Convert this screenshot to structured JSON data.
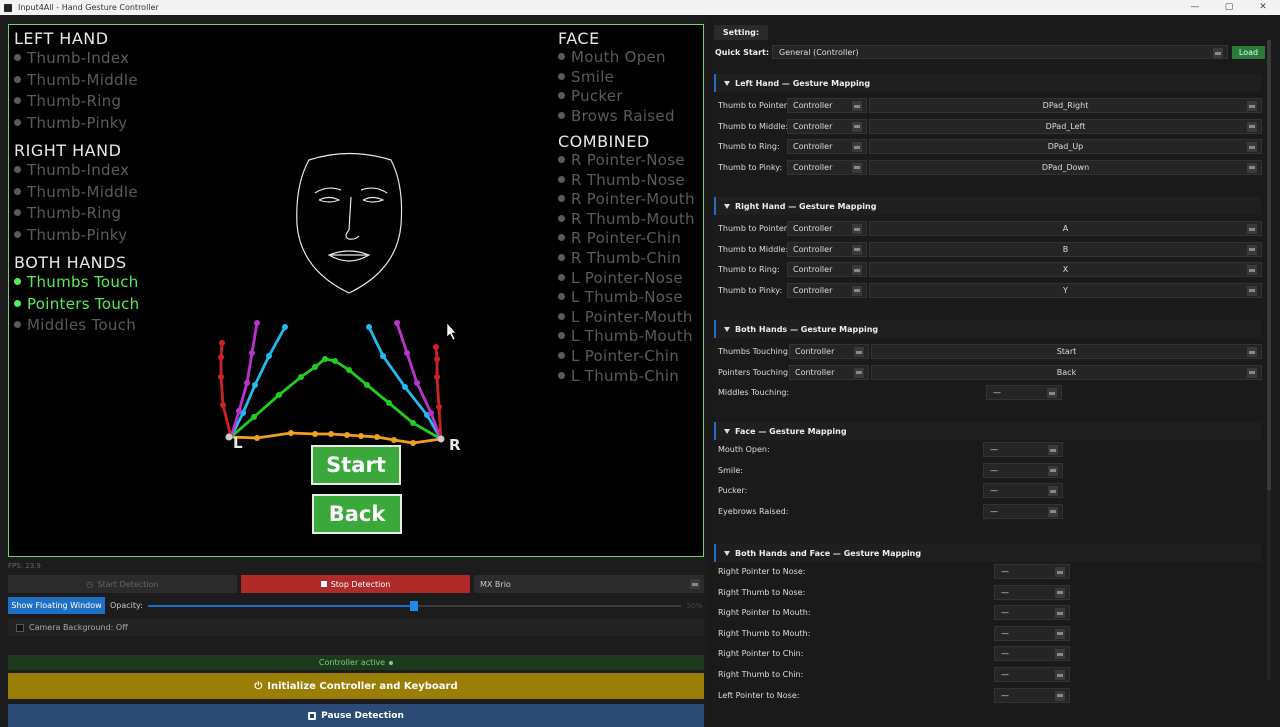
{
  "window": {
    "title": "Input4All - Hand Gesture Controller",
    "controls": [
      "—",
      "▢",
      "✕"
    ]
  },
  "camera": {
    "left_hand": {
      "title": "LEFT HAND",
      "items": [
        {
          "label": "Thumb-Index",
          "active": false
        },
        {
          "label": "Thumb-Middle",
          "active": false
        },
        {
          "label": "Thumb-Ring",
          "active": false
        },
        {
          "label": "Thumb-Pinky",
          "active": false
        }
      ]
    },
    "right_hand": {
      "title": "RIGHT HAND",
      "items": [
        {
          "label": "Thumb-Index",
          "active": false
        },
        {
          "label": "Thumb-Middle",
          "active": false
        },
        {
          "label": "Thumb-Ring",
          "active": false
        },
        {
          "label": "Thumb-Pinky",
          "active": false
        }
      ]
    },
    "both_hands": {
      "title": "BOTH HANDS",
      "items": [
        {
          "label": "Thumbs Touch",
          "active": true
        },
        {
          "label": "Pointers Touch",
          "active": true
        },
        {
          "label": "Middles Touch",
          "active": false
        }
      ]
    },
    "face": {
      "title": "FACE",
      "items": [
        {
          "label": "Mouth Open",
          "active": false
        },
        {
          "label": "Smile",
          "active": false
        },
        {
          "label": "Pucker",
          "active": false
        },
        {
          "label": "Brows Raised",
          "active": false
        }
      ]
    },
    "combined": {
      "title": "COMBINED",
      "items": [
        {
          "label": "R Pointer-Nose",
          "active": false
        },
        {
          "label": "R Thumb-Nose",
          "active": false
        },
        {
          "label": "R Pointer-Mouth",
          "active": false
        },
        {
          "label": "R Thumb-Mouth",
          "active": false
        },
        {
          "label": "R Pointer-Chin",
          "active": false
        },
        {
          "label": "R Thumb-Chin",
          "active": false
        },
        {
          "label": "L Pointer-Nose",
          "active": false
        },
        {
          "label": "L Thumb-Nose",
          "active": false
        },
        {
          "label": "L Pointer-Mouth",
          "active": false
        },
        {
          "label": "L Thumb-Mouth",
          "active": false
        },
        {
          "label": "L Pointer-Chin",
          "active": false
        },
        {
          "label": "L Thumb-Chin",
          "active": false
        }
      ]
    },
    "overlay": {
      "start_label": "Start",
      "back_label": "Back",
      "left_marker": "L",
      "right_marker": "R"
    },
    "colors": {
      "active": "#55ee55",
      "inactive": "#5a5a5a",
      "border": "#6fcf73"
    }
  },
  "fps": "FPS: 23.9",
  "controls": {
    "start_detection": "Start Detection",
    "stop_detection": "Stop Detection",
    "camera_select": "MX Brio",
    "show_floating": "Show Floating Window",
    "opacity_label": "Opacity:",
    "opacity_value": 0.5,
    "opacity_text": "50%",
    "camera_background": "Camera Background: Off",
    "status": "Controller active",
    "initialize": "Initialize Controller and Keyboard",
    "pause": "Pause Detection"
  },
  "settings": {
    "tab": "Setting:",
    "quick_start_label": "Quick Start:",
    "quick_start_value": "General (Controller)",
    "load_label": "Load",
    "left_hand": {
      "title": "Left Hand — Gesture Mapping",
      "rows": [
        {
          "label": "Thumb to Pointer:",
          "device": "Controller",
          "value": "DPad_Right"
        },
        {
          "label": "Thumb to Middle:",
          "device": "Controller",
          "value": "DPad_Left"
        },
        {
          "label": "Thumb to Ring:",
          "device": "Controller",
          "value": "DPad_Up"
        },
        {
          "label": "Thumb to Pinky:",
          "device": "Controller",
          "value": "DPad_Down"
        }
      ]
    },
    "right_hand": {
      "title": "Right Hand — Gesture Mapping",
      "rows": [
        {
          "label": "Thumb to Pointer:",
          "device": "Controller",
          "value": "A"
        },
        {
          "label": "Thumb to Middle:",
          "device": "Controller",
          "value": "B"
        },
        {
          "label": "Thumb to Ring:",
          "device": "Controller",
          "value": "X"
        },
        {
          "label": "Thumb to Pinky:",
          "device": "Controller",
          "value": "Y"
        }
      ]
    },
    "both_hands": {
      "title": "Both Hands — Gesture Mapping",
      "rows": [
        {
          "label": "Thumbs Touching:",
          "device": "Controller",
          "value": "Start"
        },
        {
          "label": "Pointers Touching:",
          "device": "Controller",
          "value": "Back"
        }
      ],
      "middles_label": "Middles Touching:",
      "middles_value": "—"
    },
    "face": {
      "title": "Face — Gesture Mapping",
      "rows": [
        {
          "label": "Mouth Open:",
          "value": "—"
        },
        {
          "label": "Smile:",
          "value": "—"
        },
        {
          "label": "Pucker:",
          "value": "—"
        },
        {
          "label": "Eyebrows Raised:",
          "value": "—"
        }
      ]
    },
    "combined": {
      "title": "Both Hands and Face — Gesture Mapping",
      "rows": [
        {
          "label": "Right Pointer to Nose:",
          "value": "—"
        },
        {
          "label": "Right Thumb to Nose:",
          "value": "—"
        },
        {
          "label": "Right Pointer to Mouth:",
          "value": "—"
        },
        {
          "label": "Right Thumb to Mouth:",
          "value": "—"
        },
        {
          "label": "Right Pointer to Chin:",
          "value": "—"
        },
        {
          "label": "Right Thumb to Chin:",
          "value": "—"
        },
        {
          "label": "Left Pointer to Nose:",
          "value": "—"
        }
      ]
    }
  }
}
